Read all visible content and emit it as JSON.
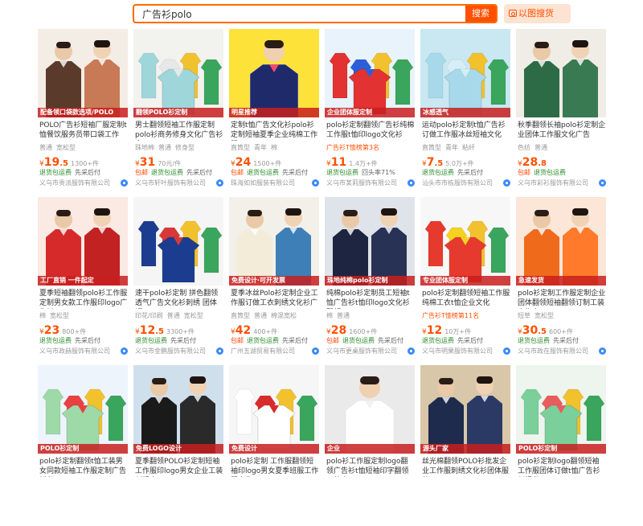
{
  "search": {
    "query": "广告衫polo",
    "button_label": "搜索",
    "image_search_label": "以图搜货"
  },
  "products": [
    {
      "title": "POLO广告衫短袖厂服定制t恤餐饮服务员带口袋工作",
      "tags": [
        "普通",
        "宽松型"
      ],
      "hot": "",
      "price_int": "19",
      "price_dec": ".5",
      "sales": "1300+件",
      "svc": [
        "退货包运费",
        "先采后付"
      ],
      "svc_red": false,
      "shop": "义乌市贵派服饰有限公司",
      "img_label": "配备领口袋款选项/POLO",
      "bg": "#f4ede6",
      "shirt": "#5a3a2a",
      "shirt2": "#c77a55",
      "people": 2
    },
    {
      "title": "男士翻领短袖工作服定制polo衫商务修身文化广告衫企",
      "tags": [
        "珠地棉",
        "普通",
        "修身型"
      ],
      "hot": "",
      "price_int": "31",
      "price_dec": "",
      "sales": "70元/件",
      "svc": [
        "包邮",
        "退货包运费",
        "先采后付"
      ],
      "svc_red": true,
      "shop": "义乌市轩叶服饰有限公司",
      "img_label": "翻领POLO衫定制",
      "bg": "#f2f2ef",
      "shirt": "#9fd6d9",
      "shirt2": "#e8e8e8",
      "people": 0
    },
    {
      "title": "定制t恤广告文化衫polo衫定制短袖夏季企业纯棉工作服",
      "tags": [
        "直筒型",
        "青年",
        "棉"
      ],
      "hot": "",
      "price_int": "24",
      "price_dec": "",
      "sales": "1500+件",
      "svc": [
        "包邮",
        "退货包运费",
        "先采后付"
      ],
      "svc_red": true,
      "shop": "珠海如如服装有限公司",
      "img_label": "明星推荐",
      "bg": "#fde23a",
      "shirt": "#1f2a6a",
      "shirt2": "#f04a6e",
      "people": 1
    },
    {
      "title": "polo衫定制翻领广告衫纯棉工作服t恤印logo文化衫",
      "tags": [
        "广告衫T恤榜第3名"
      ],
      "hot": "广告衫T恤榜第3名",
      "price_int": "11",
      "price_dec": "",
      "sales": "1.4万+件",
      "svc": [
        "退货包运费",
        "回头率71%"
      ],
      "svc_red": false,
      "shop": "义乌市某莉服饰有限公司",
      "img_label": "企业团体服定制",
      "bg": "#e8f3fb",
      "shirt": "#e23232",
      "shirt2": "#2b5fd9",
      "people": 0
    },
    {
      "title": "运动polo衫定制t恤广告衫订做工作服冰丝短袖文化",
      "tags": [
        "直筒型",
        "青年",
        "粘纤"
      ],
      "hot": "",
      "price_int": "7",
      "price_dec": ".5",
      "sales": "5.0万+件",
      "svc": [
        "退货包运费",
        "先采后付"
      ],
      "svc_red": false,
      "shop": "汕头市市栋服饰有限公司",
      "img_label": "冰感透气",
      "bg": "#c9e8f2",
      "shirt": "#a8d9ea",
      "shirt2": "#d6eef5",
      "people": 0
    },
    {
      "title": "秋季翻领长袖polo衫定制企业团体工作服文化广告",
      "tags": [
        "色纺",
        "普通"
      ],
      "hot": "",
      "price_int": "28",
      "price_dec": ".8",
      "sales": "",
      "svc": [
        "包邮",
        "退货包运费"
      ],
      "svc_red": true,
      "shop": "义乌市彩衫服饰有限公司",
      "img_label": "",
      "bg": "#f0ece6",
      "shirt": "#2d6b46",
      "shirt2": "#3a7a52",
      "people": 2
    },
    {
      "title": "夏季短袖翻领polo衫工作服定制男女款工作服印logo广告衫",
      "tags": [
        "棉",
        "宽松型"
      ],
      "hot": "",
      "price_int": "23",
      "price_dec": "",
      "sales": "800+件",
      "svc": [
        "退货包运费",
        "先采后付"
      ],
      "svc_red": false,
      "shop": "义乌市政赫服饰有限公司",
      "img_label": "工厂直销 一件起定",
      "bg": "#fbe9e4",
      "shirt": "#d62a2a",
      "shirt2": "#c22222",
      "people": 2
    },
    {
      "title": "速干polo衫定制 拼色翻领透气广告文化衫刺绣 团体短",
      "tags": [
        "印花/印刷",
        "普通",
        "宽松型"
      ],
      "hot": "",
      "price_int": "12",
      "price_dec": ".5",
      "sales": "3300+件",
      "svc": [
        "退货包运费",
        "先采后付"
      ],
      "svc_red": false,
      "shop": "义乌市金鹏服饰有限公司",
      "img_label": "",
      "bg": "#f5f5f5",
      "shirt": "#1c3d8f",
      "shirt2": "#d93838",
      "people": 0
    },
    {
      "title": "夏季冰丝Polo衫定制企业工作服订做工衣刺绣文化衫广",
      "tags": [
        "直筒型",
        "普通",
        "棉混宽松"
      ],
      "hot": "",
      "price_int": "42",
      "price_dec": "",
      "sales": "400+件",
      "svc": [
        "包邮",
        "退货包运费",
        "先采后付"
      ],
      "svc_red": true,
      "shop": "广州五湖贸易有限公司",
      "img_label": "免费设计·可开发票",
      "bg": "#f3f0ea",
      "shirt": "#f3ecd8",
      "shirt2": "#3e7fb8",
      "people": 2
    },
    {
      "title": "纯棉polo衫定制员工短袖t恤广告衫t恤印logo文化衫翻领工",
      "tags": [
        "棉",
        "普通"
      ],
      "hot": "",
      "price_int": "28",
      "price_dec": "",
      "sales": "1600+件",
      "svc": [
        "包邮",
        "退货包运费",
        "先采后付"
      ],
      "svc_red": true,
      "shop": "义乌市更桌服饰有限公司",
      "img_label": "珠地纯棉polo衫定制",
      "bg": "#dfe3ea",
      "shirt": "#1d2540",
      "shirt2": "#283255",
      "people": 2
    },
    {
      "title": "polo衫定制翻领短袖工作服 纯棉工衣t恤企业文化",
      "tags": [
        "广告衫T恤榜第11名"
      ],
      "hot": "广告衫T恤榜第11名",
      "price_int": "12",
      "price_dec": "",
      "sales": "10万+件",
      "svc": [
        "退货包运费",
        "先采后付"
      ],
      "svc_red": false,
      "shop": "义乌市明果服饰有限公司",
      "img_label": "专业团体服定制",
      "bg": "#f7f7f7",
      "shirt": "#e63a2e",
      "shirt2": "#f4d21f",
      "people": 0
    },
    {
      "title": "polo衫定制工作服定制企业团体翻领短袖翻领订制工装广告文",
      "tags": [
        "短草",
        "宽松型"
      ],
      "hot": "",
      "price_int": "30",
      "price_dec": ".5",
      "sales": "600+件",
      "svc": [
        "退货包运费",
        "先采后付"
      ],
      "svc_red": false,
      "shop": "义乌市政在服饰有限公司",
      "img_label": "急速发货",
      "bg": "#fbe6d8",
      "shirt": "#f06a1c",
      "shirt2": "#ff7a2a",
      "people": 2
    },
    {
      "title": "polo衫定制翻领t恤工装男女同款短袖工作服定制广告衫印",
      "tags": [],
      "hot": "",
      "price_int": "",
      "price_dec": "",
      "sales": "",
      "svc": [],
      "svc_red": false,
      "shop": "",
      "img_label": "POLO衫定制",
      "bg": "#eef4fb",
      "shirt": "#9ed9a8",
      "shirt2": "#e84141",
      "people": 0
    },
    {
      "title": "夏季翻领POLO衫定制短袖工作服印logo男女企业工装刺绣文",
      "tags": [],
      "hot": "",
      "price_int": "",
      "price_dec": "",
      "sales": "",
      "svc": [],
      "svc_red": false,
      "shop": "",
      "img_label": "免费LOGO设计",
      "bg": "#cfe0ec",
      "shirt": "#1a1a1a",
      "shirt2": "#2a2a2a",
      "people": 2
    },
    {
      "title": "polo衫定制 工作服翻领短袖印logo男女夏季班服工作服文化",
      "tags": [],
      "hot": "",
      "price_int": "",
      "price_dec": "",
      "sales": "",
      "svc": [],
      "svc_red": false,
      "shop": "",
      "img_label": "免费设计",
      "bg": "#f6f6f6",
      "shirt": "#ffffff",
      "shirt2": "#d82b2b",
      "people": 0
    },
    {
      "title": "polo衫工作服定制logo翻领广告衫t恤短袖印字翻领工装广",
      "tags": [],
      "hot": "",
      "price_int": "",
      "price_dec": "",
      "sales": "",
      "svc": [],
      "svc_red": false,
      "shop": "",
      "img_label": "企业",
      "bg": "#eaeaea",
      "shirt": "#ffffff",
      "shirt2": "#f1f1f1",
      "people": 1
    },
    {
      "title": "丝光棉翻领POLO衫批发企业工作服刺绣文化衫团体服装",
      "tags": [],
      "hot": "",
      "price_int": "",
      "price_dec": "",
      "sales": "",
      "svc": [],
      "svc_red": false,
      "shop": "",
      "img_label": "源头厂家",
      "bg": "#d8c7a8",
      "shirt": "#1e2b4d",
      "shirt2": "#2a3a65",
      "people": 2
    },
    {
      "title": "polo衫定制logo翻领短袖工作服团体订做t恤广告衫刺绣印",
      "tags": [],
      "hot": "",
      "price_int": "",
      "price_dec": "",
      "sales": "",
      "svc": [],
      "svc_red": false,
      "shop": "",
      "img_label": "POLO衫定制",
      "bg": "#eef5ee",
      "shirt": "#7bcf9a",
      "shirt2": "#e95d5d",
      "people": 0
    }
  ]
}
